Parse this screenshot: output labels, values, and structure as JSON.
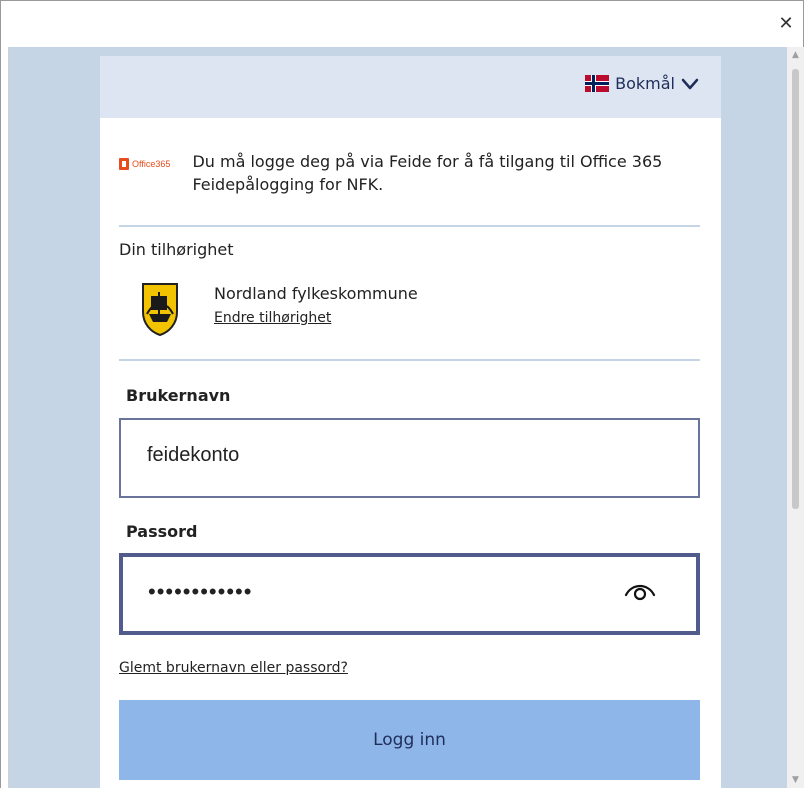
{
  "window": {
    "close_glyph": "✕"
  },
  "language": {
    "label": "Bokmål",
    "flag_icon": "norway-flag-icon"
  },
  "intro": {
    "logo_text": "Office365",
    "message": "Du må logge deg på via Feide for å få tilgang til Office 365 Feidepålogging for NFK."
  },
  "affiliation": {
    "label": "Din tilhørighet",
    "organization": "Nordland fylkeskommune",
    "change_link": "Endre tilhørighet"
  },
  "username": {
    "label": "Brukernavn",
    "value": "feidekonto"
  },
  "password": {
    "label": "Passord",
    "masked_value": "••••••••••••"
  },
  "forgot_link": "Glemt brukernavn eller passord?",
  "login_button": "Logg inn",
  "colors": {
    "page_background": "#c6d5e6",
    "header_background": "#dce5f1",
    "button_background": "#8fb6e9",
    "input_border": "#515c8c"
  }
}
